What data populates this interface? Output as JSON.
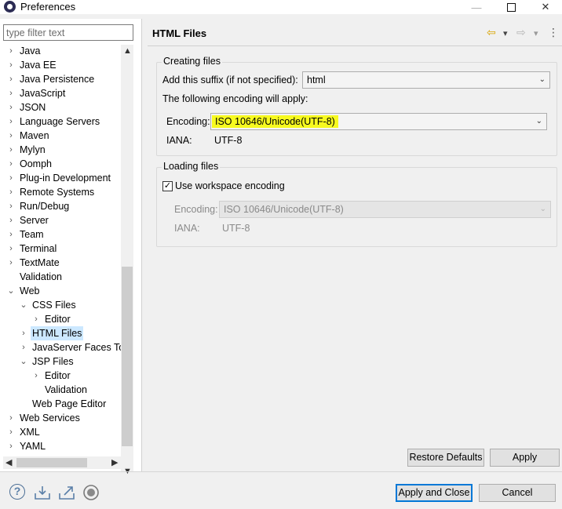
{
  "window": {
    "title": "Preferences",
    "minimize_icon": "minimize-icon",
    "maximize_icon": "maximize-icon",
    "close_glyph": "✕"
  },
  "filter": {
    "placeholder": "type filter text",
    "value": ""
  },
  "tree": {
    "items": [
      {
        "label": "Java",
        "twisty": "›"
      },
      {
        "label": "Java EE",
        "twisty": "›"
      },
      {
        "label": "Java Persistence",
        "twisty": "›"
      },
      {
        "label": "JavaScript",
        "twisty": "›"
      },
      {
        "label": "JSON",
        "twisty": "›"
      },
      {
        "label": "Language Servers",
        "twisty": "›"
      },
      {
        "label": "Maven",
        "twisty": "›"
      },
      {
        "label": "Mylyn",
        "twisty": "›"
      },
      {
        "label": "Oomph",
        "twisty": "›"
      },
      {
        "label": "Plug-in Development",
        "twisty": "›"
      },
      {
        "label": "Remote Systems",
        "twisty": "›"
      },
      {
        "label": "Run/Debug",
        "twisty": "›"
      },
      {
        "label": "Server",
        "twisty": "›"
      },
      {
        "label": "Team",
        "twisty": "›"
      },
      {
        "label": "Terminal",
        "twisty": "›"
      },
      {
        "label": "TextMate",
        "twisty": "›"
      },
      {
        "label": "Validation",
        "twisty": ""
      },
      {
        "label": "Web",
        "twisty": "⌄"
      },
      {
        "label": "CSS Files",
        "twisty": "⌄"
      },
      {
        "label": "Editor",
        "twisty": "›"
      },
      {
        "label": "HTML Files",
        "twisty": "›",
        "selected": true
      },
      {
        "label": "JavaServer Faces Tools",
        "twisty": "›"
      },
      {
        "label": "JSP Files",
        "twisty": "⌄"
      },
      {
        "label": "Editor",
        "twisty": "›"
      },
      {
        "label": "Validation",
        "twisty": ""
      },
      {
        "label": "Web Page Editor",
        "twisty": ""
      },
      {
        "label": "Web Services",
        "twisty": "›"
      },
      {
        "label": "XML",
        "twisty": "›"
      },
      {
        "label": "YAML",
        "twisty": "›"
      }
    ]
  },
  "page": {
    "title": "HTML Files",
    "nav": {
      "back_icon": "⇦",
      "back_menu_icon": "▾",
      "forward_icon": "⇨",
      "forward_menu_icon": "▾",
      "more_icon": "⋮"
    },
    "creating": {
      "legend": "Creating files",
      "suffix_label": "Add this suffix (if not specified):",
      "suffix_value": "html",
      "encoding_note": "The following encoding will apply:",
      "encoding_label": "Encoding:",
      "encoding_value": "ISO 10646/Unicode(UTF-8)",
      "iana_label": "IANA:",
      "iana_value": "UTF-8"
    },
    "loading": {
      "legend": "Loading files",
      "workspace_label": "Use workspace encoding",
      "workspace_checked": true,
      "encoding_label": "Encoding:",
      "encoding_value": "ISO 10646/Unicode(UTF-8)",
      "iana_label": "IANA:",
      "iana_value": "UTF-8"
    },
    "restore_defaults": "Restore Defaults",
    "apply": "Apply"
  },
  "footer": {
    "apply_close": "Apply and Close",
    "cancel": "Cancel",
    "icons": [
      "help-icon",
      "import-icon",
      "export-icon",
      "record-icon"
    ]
  },
  "colors": {
    "highlight": "#f7fa1f",
    "selection": "#cce8ff",
    "default_button_border": "#0078d7"
  }
}
